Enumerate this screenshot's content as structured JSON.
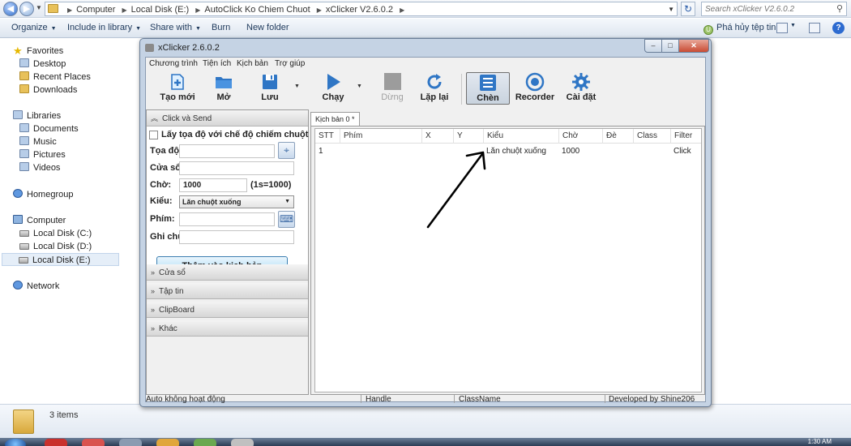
{
  "explorer": {
    "breadcrumbs": [
      "Computer",
      "Local Disk (E:)",
      "AutoClick Ko Chiem Chuot",
      "xClicker V2.6.0.2"
    ],
    "search_placeholder": "Search xClicker V2.6.0.2",
    "commands": {
      "organize": "Organize",
      "include": "Include in library",
      "share": "Share with",
      "burn": "Burn",
      "new_folder": "New folder",
      "uninstall": "Phá hủy tệp tin"
    },
    "nav": {
      "favorites": "Favorites",
      "desktop": "Desktop",
      "recent": "Recent Places",
      "downloads": "Downloads",
      "libraries": "Libraries",
      "documents": "Documents",
      "music": "Music",
      "pictures": "Pictures",
      "videos": "Videos",
      "homegroup": "Homegroup",
      "computer": "Computer",
      "disk_c": "Local Disk (C:)",
      "disk_d": "Local Disk (D:)",
      "disk_e": "Local Disk (E:)",
      "network": "Network"
    },
    "status_items": "3 items",
    "clock": "1:30 AM"
  },
  "xclicker": {
    "title": "xClicker 2.6.0.2",
    "window_buttons": {
      "min": "–",
      "max": "□",
      "close": "✕"
    },
    "menu": [
      "Chương trình",
      "Tiện ích",
      "Kịch bản",
      "Trợ giúp"
    ],
    "toolbar": {
      "new": "Tạo mới",
      "open": "Mở",
      "save": "Lưu",
      "run": "Chạy",
      "stop": "Dừng",
      "repeat": "Lặp lại",
      "insert": "Chèn",
      "recorder": "Recorder",
      "settings": "Cài đặt"
    },
    "sections": {
      "click_send": "Click và Send",
      "window": "Cửa sổ",
      "file": "Tập tin",
      "clipboard": "ClipBoard",
      "other": "Khác"
    },
    "form": {
      "no_cursor_label": "Lấy tọa độ với chế độ chiếm chuột",
      "coord_label": "Tọa độ:",
      "window_label": "Cửa sổ:",
      "wait_label": "Chờ:",
      "wait_value": "1000",
      "wait_hint": "(1s=1000)",
      "type_label": "Kiểu:",
      "type_value": "Lăn chuột xuống",
      "key_label": "Phím:",
      "note_label": "Ghi chú:",
      "add_button": "Thêm vào kịch bản"
    },
    "tab_label": "Kịch bản 0 *",
    "grid": {
      "columns": [
        "STT",
        "Phím",
        "X",
        "Y",
        "Kiểu",
        "Chờ",
        "Đè",
        "Class",
        "Filter"
      ],
      "rows": [
        [
          "1",
          "",
          "",
          "",
          "Lăn chuột xuống",
          "1000",
          "",
          "",
          "Click"
        ]
      ]
    },
    "statusbar": {
      "state": "Auto không hoạt động",
      "handle": "Handle",
      "classname": "ClassName",
      "developer": "Developed by Shine206"
    }
  },
  "colors": {
    "accent": "#2d69c9",
    "window_frame": "#c5d3e4",
    "add_button": "#a7d9f5"
  }
}
